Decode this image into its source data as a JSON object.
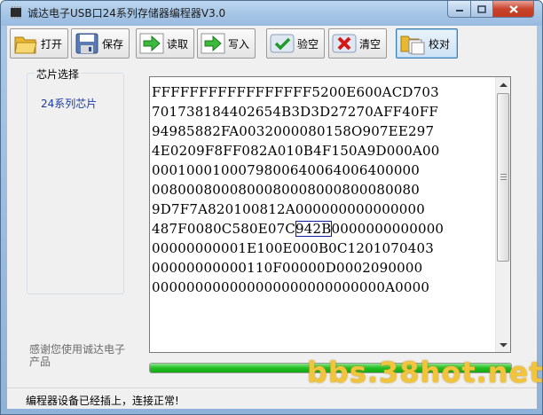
{
  "window": {
    "title": "诚达电子USB口24系列存储器编程器V3.0"
  },
  "toolbar": {
    "open_label": "打开",
    "save_label": "保存",
    "read_label": "读取",
    "write_label": "写入",
    "verify_label": "验空",
    "erase_label": "清空",
    "compare_label": "校对"
  },
  "chip_panel": {
    "title": "芯片选择",
    "item": "24系列芯片"
  },
  "thanks": "感谢您使用诚达电子产品",
  "hex": {
    "lines": [
      "FFFFFFFFFFFFFFFFF5200E600ACD703",
      "70173818440265 4B3D3D27270AFF40FF",
      "94985882FA0032000080158O907EE297",
      "4E0209F8FF082A010B4F150A9D000A00",
      "0001000100079800640064006400000",
      "0080008000800080008000800080080",
      "9D7F7A820100812A000000000000000",
      "487F0080C580E07C942B00000000000",
      "00000000001E100E000B0C1201070403",
      "00000000000110F00000D0002090000",
      "000000000000000000000000000A0000"
    ],
    "line8_before": "487F0080C580E07C",
    "line8_highlight": "942B",
    "line8_after": "0000000000000"
  },
  "progress_fraction": 1.0,
  "status": "编程器设备已经插上，连接正常!",
  "watermark": "bbs.38hot.net"
}
